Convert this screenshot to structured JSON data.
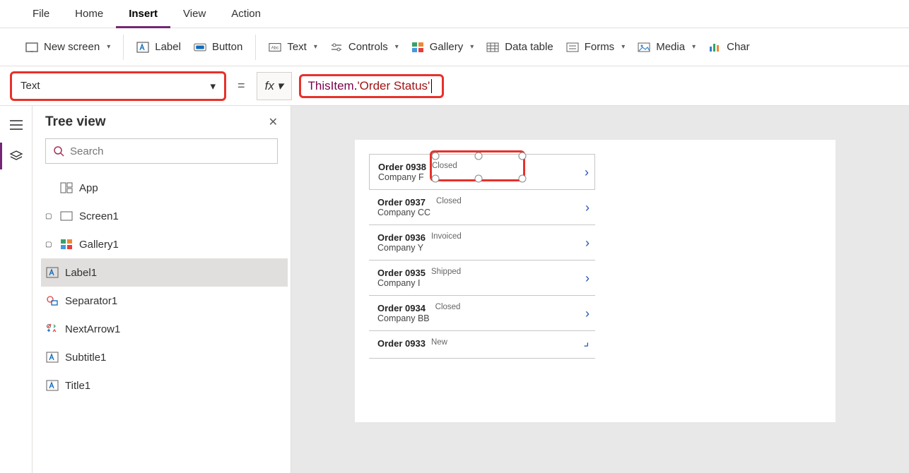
{
  "menu": {
    "items": [
      "File",
      "Home",
      "Insert",
      "View",
      "Action"
    ],
    "active": "Insert"
  },
  "ribbon": {
    "new_screen": "New screen",
    "label": "Label",
    "button": "Button",
    "text": "Text",
    "controls": "Controls",
    "gallery": "Gallery",
    "data_table": "Data table",
    "forms": "Forms",
    "media": "Media",
    "charts": "Char"
  },
  "formula": {
    "property": "Text",
    "fx": "fx",
    "eq": "=",
    "tokens": {
      "this": "ThisItem",
      "dot": ".",
      "str": "'Order Status'"
    }
  },
  "tree": {
    "title": "Tree view",
    "search_placeholder": "Search",
    "nodes": {
      "app": "App",
      "screen1": "Screen1",
      "gallery1": "Gallery1",
      "label1": "Label1",
      "separator1": "Separator1",
      "nextarrow1": "NextArrow1",
      "subtitle1": "Subtitle1",
      "title1": "Title1"
    }
  },
  "gallery_items": [
    {
      "title": "Order 0938",
      "sub": "Company F",
      "status": "Closed"
    },
    {
      "title": "Order 0937",
      "sub": "Company CC",
      "status": "Closed"
    },
    {
      "title": "Order 0936",
      "sub": "Company Y",
      "status": "Invoiced"
    },
    {
      "title": "Order 0935",
      "sub": "Company I",
      "status": "Shipped"
    },
    {
      "title": "Order 0934",
      "sub": "Company BB",
      "status": "Closed"
    },
    {
      "title": "Order 0933",
      "sub": "",
      "status": "New"
    }
  ],
  "colors": {
    "accent": "#742774",
    "highlight": "#e8302a",
    "chevron": "#2452b5"
  }
}
